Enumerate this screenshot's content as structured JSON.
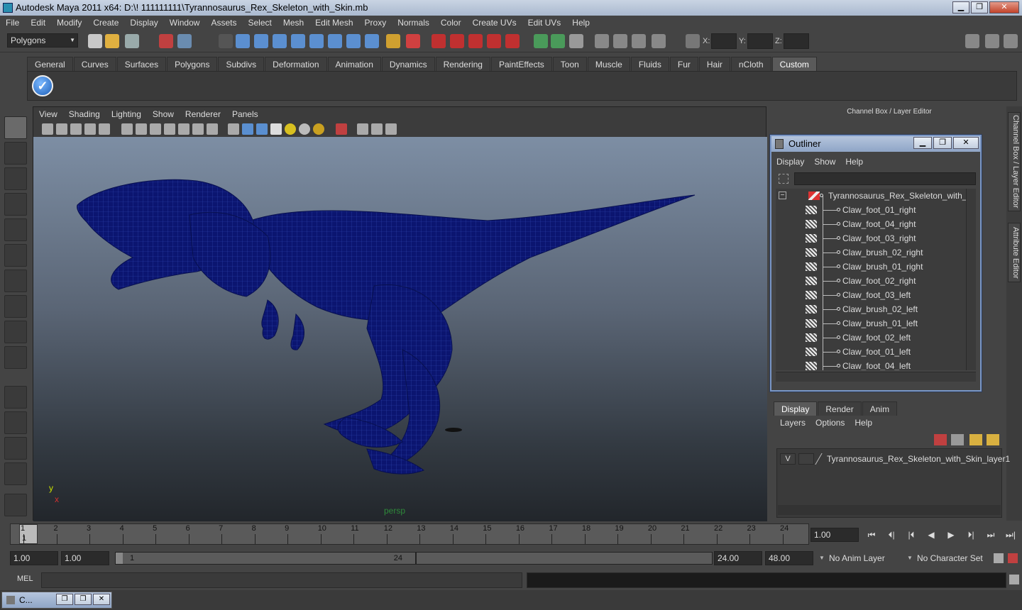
{
  "window": {
    "title": "Autodesk Maya 2011 x64: D:\\! 111111111\\Tyrannosaurus_Rex_Skeleton_with_Skin.mb",
    "min": "▁",
    "max": "❐",
    "close": "✕"
  },
  "menubar": [
    "File",
    "Edit",
    "Modify",
    "Create",
    "Display",
    "Window",
    "Assets",
    "Select",
    "Mesh",
    "Edit Mesh",
    "Proxy",
    "Normals",
    "Color",
    "Create UVs",
    "Edit UVs",
    "Help"
  ],
  "statusline": {
    "mode": "Polygons",
    "x_label": "X:",
    "y_label": "Y:",
    "z_label": "Z:"
  },
  "shelf": {
    "tabs": [
      "General",
      "Curves",
      "Surfaces",
      "Polygons",
      "Subdivs",
      "Deformation",
      "Animation",
      "Dynamics",
      "Rendering",
      "PaintEffects",
      "Toon",
      "Muscle",
      "Fluids",
      "Fur",
      "Hair",
      "nCloth",
      "Custom"
    ],
    "active": "Custom",
    "check_glyph": "✓"
  },
  "viewport": {
    "menu": [
      "View",
      "Shading",
      "Lighting",
      "Show",
      "Renderer",
      "Panels"
    ],
    "camera": "persp",
    "axis_y": "y",
    "axis_x": "x"
  },
  "channelbox": {
    "title": "Channel Box / Layer Editor"
  },
  "outliner": {
    "title": "Outliner",
    "menu": [
      "Display",
      "Show",
      "Help"
    ],
    "root": "Tyrannosaurus_Rex_Skeleton_with_Skin",
    "items": [
      "Claw_foot_01_right",
      "Claw_foot_04_right",
      "Claw_foot_03_right",
      "Claw_brush_02_right",
      "Claw_brush_01_right",
      "Claw_foot_02_right",
      "Claw_foot_03_left",
      "Claw_brush_02_left",
      "Claw_brush_01_left",
      "Claw_foot_02_left",
      "Claw_foot_01_left",
      "Claw_foot_04_left"
    ],
    "collapse_glyph": "−"
  },
  "layers": {
    "tabs": [
      "Display",
      "Render",
      "Anim"
    ],
    "active": "Display",
    "menu": [
      "Layers",
      "Options",
      "Help"
    ],
    "layer_v": "V",
    "layer_name": "Tyrannosaurus_Rex_Skeleton_with_Skin_layer1"
  },
  "sidetabs": [
    "Channel Box / Layer Editor",
    "Attribute Editor"
  ],
  "timeslider": {
    "ticks": [
      "1",
      "2",
      "3",
      "4",
      "5",
      "6",
      "7",
      "8",
      "9",
      "10",
      "11",
      "12",
      "13",
      "14",
      "15",
      "16",
      "17",
      "18",
      "19",
      "20",
      "21",
      "22",
      "23",
      "24"
    ],
    "current_frame": "1",
    "current_time": "1.00"
  },
  "playback": [
    "⏮",
    "⏴|",
    "|⏴",
    "◀",
    "▶",
    "⏵|",
    "⏭",
    "⏭|"
  ],
  "range": {
    "start": "1.00",
    "playback_start": "1.00",
    "slider_start": "1",
    "slider_end": "24",
    "playback_end": "24.00",
    "end": "48.00",
    "anim_layer": "No Anim Layer",
    "character_set": "No Character Set"
  },
  "cmdline": {
    "label": "MEL"
  },
  "taskbar": {
    "label": "C..."
  },
  "colors": {
    "wireframe": "#0b1570",
    "accent": "#7a96c4"
  }
}
